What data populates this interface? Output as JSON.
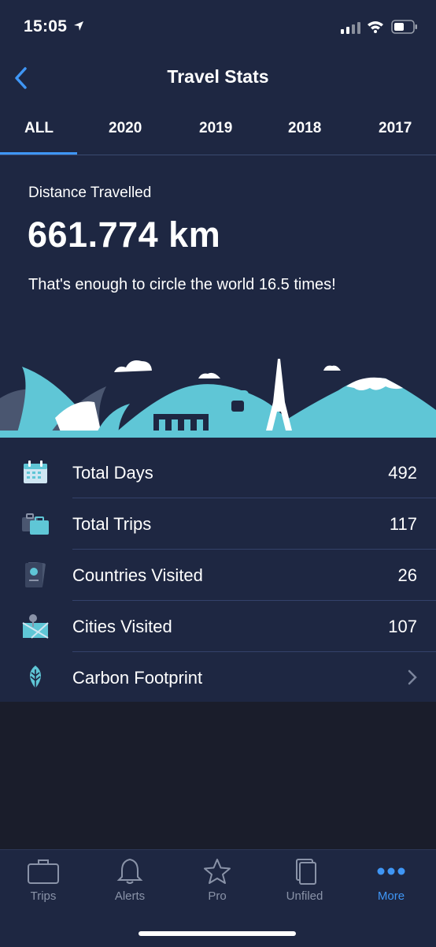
{
  "status_bar": {
    "time": "15:05"
  },
  "nav": {
    "title": "Travel Stats"
  },
  "tabs": [
    {
      "label": "ALL",
      "active": true
    },
    {
      "label": "2020"
    },
    {
      "label": "2019"
    },
    {
      "label": "2018"
    },
    {
      "label": "2017"
    }
  ],
  "distance": {
    "label": "Distance Travelled",
    "value": "661.774 km",
    "caption": "That's enough to circle the world 16.5 times!"
  },
  "stats": [
    {
      "label": "Total Days",
      "value": "492",
      "icon": "calendar-icon"
    },
    {
      "label": "Total Trips",
      "value": "117",
      "icon": "suitcase-icon"
    },
    {
      "label": "Countries Visited",
      "value": "26",
      "icon": "passport-icon"
    },
    {
      "label": "Cities Visited",
      "value": "107",
      "icon": "map-pin-icon"
    },
    {
      "label": "Carbon Footprint",
      "value": "",
      "icon": "leaf-icon"
    }
  ],
  "tabbar": [
    {
      "label": "Trips",
      "icon": "briefcase-icon"
    },
    {
      "label": "Alerts",
      "icon": "bell-icon"
    },
    {
      "label": "Pro",
      "icon": "star-icon"
    },
    {
      "label": "Unfiled",
      "icon": "documents-icon"
    },
    {
      "label": "More",
      "icon": "more-dots-icon",
      "active": true
    }
  ],
  "colors": {
    "accent": "#3f96f5",
    "panel": "#1e2742",
    "background": "#1a1d2b"
  }
}
